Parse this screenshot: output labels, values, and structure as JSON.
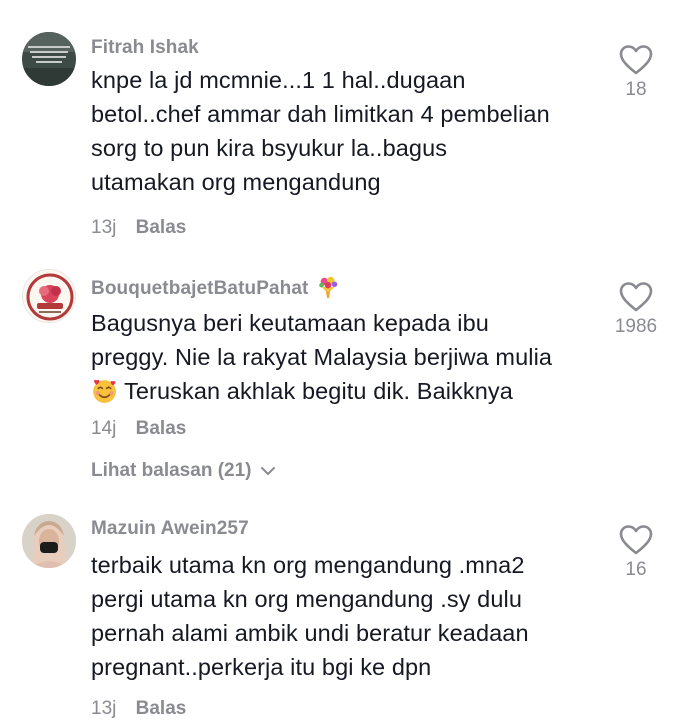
{
  "comments": [
    {
      "username": "Fitrah Ishak",
      "lines": [
        "knpe la jd mcmnie...1 1 hal..dugaan",
        "betol..chef ammar dah limitkan 4 pembelian",
        "sorg to pun kira bsyukur la..bagus",
        "utamakan org mengandung"
      ],
      "time": "13j",
      "reply_label": "Balas",
      "likes": "18",
      "avatar_text": "GREAT CAKES YEARS TO BUILD SECONDS TO BREAK AND YOU'VE DO NOTHING"
    },
    {
      "username": "BouquetbajetBatuPahat",
      "username_emoji": "bouquet-emoji",
      "lines": [
        "Bagusnya beri keutamaan kepada ibu",
        "preggy. Nie la rakyat Malaysia berjiwa mulia",
        "Teruskan akhlak begitu dik. Baikknya"
      ],
      "line3_emoji": "smiling-face-with-hearts-emoji",
      "time": "14j",
      "reply_label": "Balas",
      "likes": "1986",
      "view_replies": "Lihat balasan (21)",
      "avatar_text": "Bouquet Bajet"
    },
    {
      "username": "Mazuin Awein257",
      "lines": [
        "terbaik utama kn org mengandung .mna2",
        "pergi utama kn org mengandung .sy dulu",
        "pernah alami ambik undi beratur keadaan",
        "pregnant..perkerja itu bgi ke dpn"
      ],
      "time": "13j",
      "reply_label": "Balas",
      "likes": "16"
    }
  ],
  "colors": {
    "text": "#161823",
    "secondary": "#8a8b91",
    "background": "#ffffff"
  }
}
